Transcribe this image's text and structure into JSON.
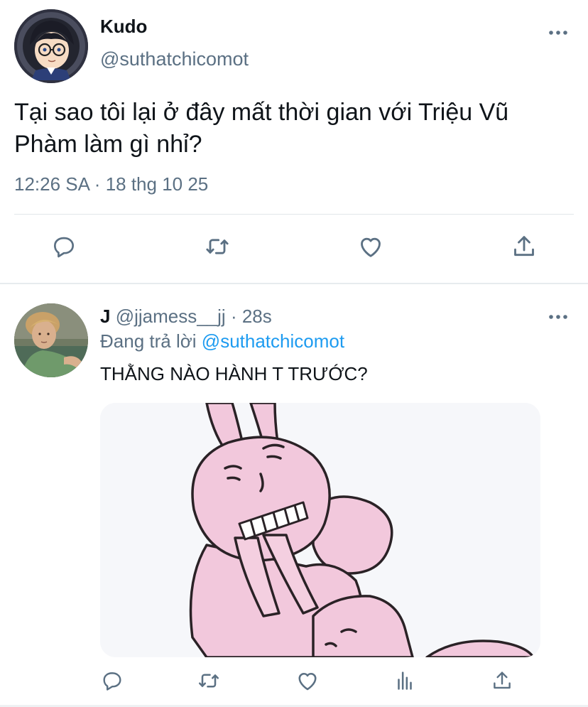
{
  "main_tweet": {
    "display_name": "Kudo",
    "handle": "@suthatchicomot",
    "text_line1": "Tại sao tôi lại ở đây mất thời gian với Triệu Vũ",
    "text_line2": "Phàm làm gì nhỉ?",
    "time": "12:26 SA",
    "separator": "·",
    "date": "18 thg 10 25",
    "actions": [
      "reply-icon",
      "retweet-icon",
      "like-icon",
      "share-icon"
    ]
  },
  "reply": {
    "display_name": "J",
    "handle": "@jjamess__jj",
    "separator": "·",
    "age": "28s",
    "replying_prefix": "Đang trả lời",
    "replying_to": "@suthatchicomot",
    "text": "THẰNG NÀO HÀNH T TRƯỚC?",
    "actions": [
      "reply-icon",
      "retweet-icon",
      "like-icon",
      "analytics-icon",
      "share-icon"
    ]
  },
  "colors": {
    "text": "#0f1419",
    "secondary": "#5b7083",
    "link": "#1d9bf0",
    "divider": "#e1e6ea",
    "bunny_pink": "#f2c8dc"
  }
}
